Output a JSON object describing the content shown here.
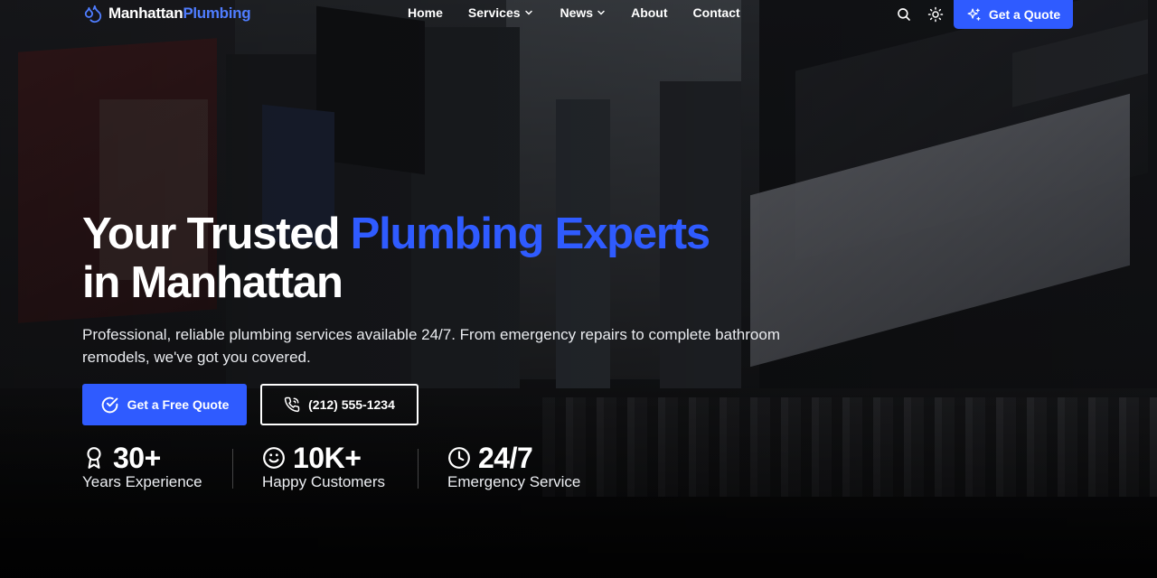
{
  "brand": {
    "name_part1": "Manhattan",
    "name_part2": "Plumbing",
    "accent_color": "#2f5bff"
  },
  "nav": {
    "items": [
      {
        "label": "Home",
        "has_dropdown": false
      },
      {
        "label": "Services",
        "has_dropdown": true
      },
      {
        "label": "News",
        "has_dropdown": true
      },
      {
        "label": "About",
        "has_dropdown": false
      },
      {
        "label": "Contact",
        "has_dropdown": false
      }
    ],
    "search_icon": "search-icon",
    "theme_icon": "sun-icon",
    "cta_label": "Get a Quote",
    "cta_icon": "sparkles-icon"
  },
  "hero": {
    "title_line1_plain": "Your Trusted ",
    "title_line1_accent": "Plumbing Experts",
    "title_line2": "in Manhattan",
    "subtitle": "Professional, reliable plumbing services available 24/7. From emergency repairs to complete bathroom remodels, we've got you covered.",
    "primary_button": {
      "label": "Get a Free Quote",
      "icon": "check-circle-icon"
    },
    "secondary_button": {
      "label": "(212) 555-1234",
      "icon": "phone-icon"
    }
  },
  "stats": [
    {
      "value": "30+",
      "label": "Years Experience",
      "icon": "award-icon"
    },
    {
      "value": "10K+",
      "label": "Happy Customers",
      "icon": "smile-icon"
    },
    {
      "value": "24/7",
      "label": "Emergency Service",
      "icon": "clock-icon"
    }
  ]
}
